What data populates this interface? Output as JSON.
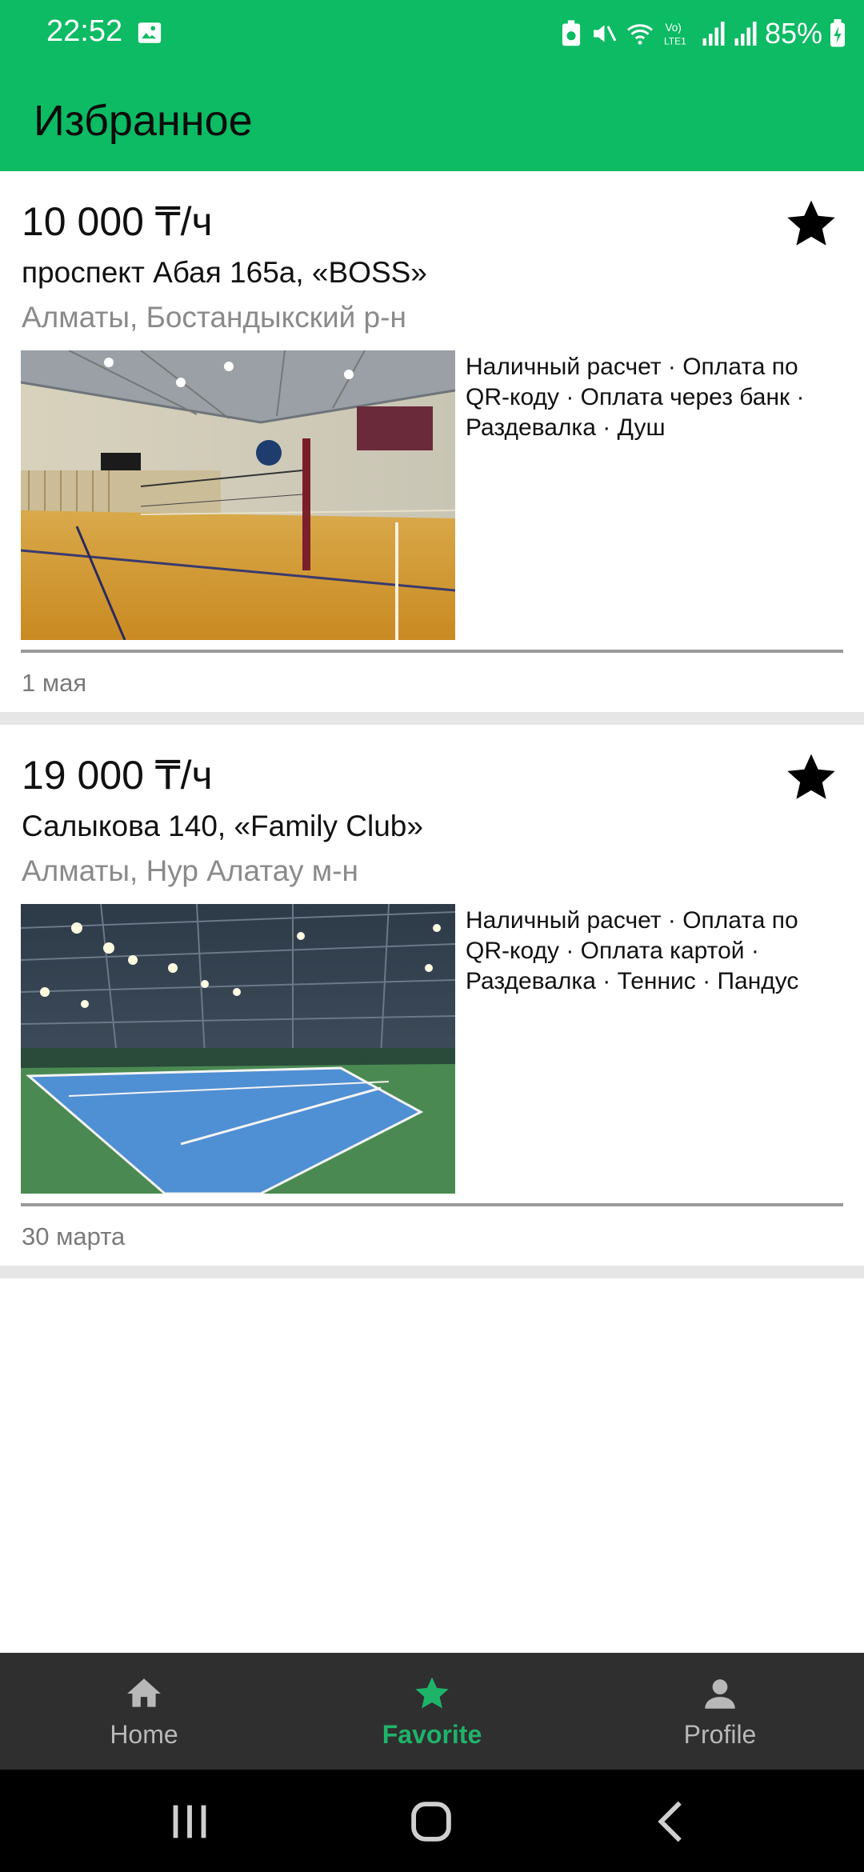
{
  "status": {
    "time": "22:52",
    "battery": "85%"
  },
  "header": {
    "title": "Избранное"
  },
  "listings": [
    {
      "price": "10 000 ₸/ч",
      "address": "проспект Абая 165а, «BOSS»",
      "district": "Алматы, Бостандыкский р-н",
      "amenities": "Наличный расчет · Оплата по QR-коду · Оплата через банк · Раздевалка · Душ",
      "date": "1 мая",
      "favorite_icon": "star-icon"
    },
    {
      "price": "19 000 ₸/ч",
      "address": "Салыкова 140, «Family Club»",
      "district": "Алматы, Нур Алатау м-н",
      "amenities": "Наличный расчет · Оплата по QR-коду · Оплата картой · Раздевалка · Теннис · Пандус",
      "date": "30 марта",
      "favorite_icon": "star-icon"
    }
  ],
  "bottom_nav": {
    "items": [
      {
        "label": "Home",
        "icon": "home-icon"
      },
      {
        "label": "Favorite",
        "icon": "star-icon",
        "active": true
      },
      {
        "label": "Profile",
        "icon": "person-icon"
      }
    ]
  },
  "colors": {
    "accent": "#0cbb63",
    "active_nav": "#1fb36a",
    "nav_bg": "#2f2f2f"
  }
}
